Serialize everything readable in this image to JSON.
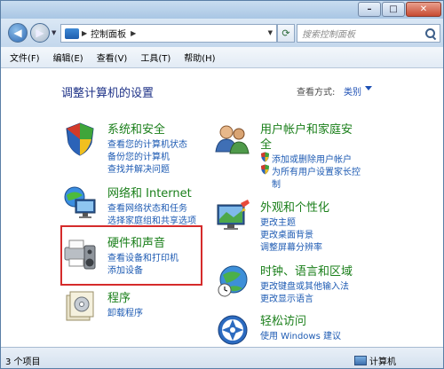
{
  "window": {
    "minimize_label": "–",
    "maximize_label": "□",
    "close_label": "✕"
  },
  "address": {
    "path": "控制面板",
    "search_placeholder": "搜索控制面板"
  },
  "menu": {
    "file": "文件(F)",
    "edit": "编辑(E)",
    "view": "查看(V)",
    "tools": "工具(T)",
    "help": "帮助(H)"
  },
  "main": {
    "heading": "调整计算机的设置",
    "view_by_label": "查看方式:",
    "view_by_value": "类别"
  },
  "categories": {
    "system_security": {
      "title": "系统和安全",
      "links": [
        "查看您的计算机状态",
        "备份您的计算机",
        "查找并解决问题"
      ]
    },
    "network": {
      "title": "网络和 Internet",
      "links": [
        "查看网络状态和任务",
        "选择家庭组和共享选项"
      ]
    },
    "hardware": {
      "title": "硬件和声音",
      "links": [
        "查看设备和打印机",
        "添加设备"
      ]
    },
    "programs": {
      "title": "程序",
      "links": [
        "卸载程序"
      ]
    },
    "user_accounts": {
      "title_line1": "用户帐户和家庭安",
      "title_line2": "全",
      "links": [
        "添加或删除用户帐户",
        "为所有用户设置家长控",
        "制"
      ]
    },
    "appearance": {
      "title": "外观和个性化",
      "links": [
        "更改主题",
        "更改桌面背景",
        "调整屏幕分辨率"
      ]
    },
    "clock_region": {
      "title": "时钟、语言和区域",
      "links": [
        "更改键盘或其他输入法",
        "更改显示语言"
      ]
    },
    "ease_access": {
      "title": "轻松访问",
      "links": [
        "使用 Windows 建议"
      ]
    }
  },
  "status": {
    "items_count": "3 个项目",
    "computer": "计算机"
  },
  "colors": {
    "category_title": "#1a7f1a",
    "link": "#1e5bb3",
    "highlight_box": "#d52b2b"
  }
}
